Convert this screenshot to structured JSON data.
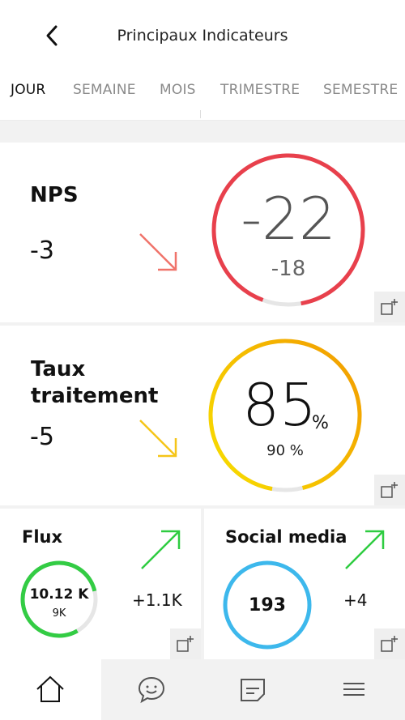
{
  "header": {
    "title": "Principaux Indicateurs"
  },
  "tabs": [
    {
      "label": "JOUR",
      "active": true
    },
    {
      "label": "SEMAINE",
      "active": false
    },
    {
      "label": "MOIS",
      "active": false
    },
    {
      "label": "TRIMESTRE",
      "active": false
    },
    {
      "label": "SEMESTRE",
      "active": false
    }
  ],
  "cards": {
    "nps": {
      "title": "NPS",
      "delta": "-3",
      "trend": "down",
      "value": "-22",
      "reference": "-18",
      "trend_color": "#f0736a",
      "ring_color": "#e8404c"
    },
    "taux": {
      "title_line1": "Taux",
      "title_line2": "traitement",
      "delta": "-5",
      "trend": "down",
      "value": "85",
      "unit": "%",
      "reference": "90 %",
      "trend_color": "#f5c518",
      "ring_color": "#f5b800"
    },
    "flux": {
      "title": "Flux",
      "delta": "+1.1K",
      "trend": "up",
      "value": "10.12 K",
      "reference": "9K",
      "trend_color": "#2ecc40",
      "ring_color": "#33cc44"
    },
    "social": {
      "title": "Social media",
      "delta": "+4",
      "trend": "up",
      "value": "193",
      "trend_color": "#2ecc40",
      "ring_color": "#3db8ec"
    }
  },
  "bottom_nav": [
    {
      "icon": "home-icon",
      "active": true
    },
    {
      "icon": "chat-icon",
      "active": false
    },
    {
      "icon": "report-icon",
      "active": false
    },
    {
      "icon": "menu-icon",
      "active": false
    }
  ]
}
